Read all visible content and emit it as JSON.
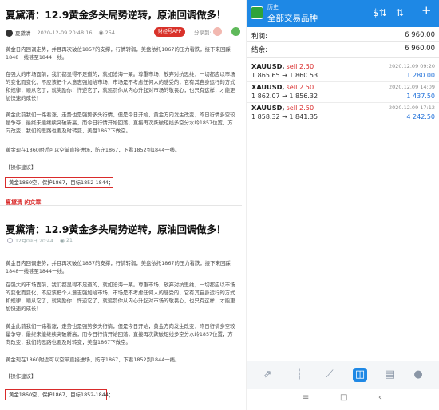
{
  "article": {
    "title": "夏黛清：12.9黄金多头局势逆转，原油回调做多！",
    "author": "夏黛清",
    "date": "2020-12-09 20:48:16",
    "views": "254",
    "app_button": "财经号APP",
    "share_label": "分享到:",
    "paragraphs": [
      "黄金日内回调走势，并且再次破位1857的支撑，行情转弱，美盘依托1867的压力看跌，接下来回踩1848一线甚至1844一线。",
      "在强大的市场面前，我们都显得不足道的，就如沧海一粟。尊重市场，放弃对抗思维，一切都应以市场的变化而变化，不应该把个人意志强加给市场，市场是不考虑任何人的感受的，它有其自身运行的方式和规律，顺从它了，就奖励你！忤逆它了，就惩罚你从内心升起对市场的敬畏心，也只有这样，才能更加快速的成长！",
      "黄金此前我们一路看涨，走势也是强势多头行情，但是今日开始，黄金方向发生改变，昨日行情多空较量争夺，最终未能继续突破新高，而今日行情开始回落，直接再次跌破短线多空分水岭1857位置，方向改变，我们的思路也要及时转变，美盘1867下做空。",
      "黄金现在1860附近可以空单直接进场，防守1867，下看1852到1844一线。"
    ],
    "advice_label": "【操作建议】",
    "advice": "黄金1860空，保护1867，目标1852-1844；",
    "source_tag": "夏黛清 的文章",
    "date2": "12月09日 20:44",
    "views2": "21"
  },
  "trading_app": {
    "history_label": "历史",
    "screen_title": "全部交易品种",
    "summary": [
      {
        "label": "利润:",
        "value": "6 960.00"
      },
      {
        "label": "结余:",
        "value": "6 960.00"
      }
    ],
    "trades": [
      {
        "symbol": "XAUUSD,",
        "side": "sell 2.50",
        "prices": "1 865.65 → 1 860.53",
        "time": "2020.12.09 09:20",
        "profit": "1 280.00"
      },
      {
        "symbol": "XAUUSD,",
        "side": "sell 2.50",
        "prices": "1 862.07 → 1 856.32",
        "time": "2020.12.09 14:09",
        "profit": "1 437.50"
      },
      {
        "symbol": "XAUUSD,",
        "side": "sell 2.50",
        "prices": "1 858.32 → 1 841.35",
        "time": "2020.12.09 17:12",
        "profit": "4 242.50"
      }
    ],
    "icons": {
      "toolbar": [
        "dollar-exchange-icon",
        "sort-icon",
        "plus-icon"
      ],
      "bottom_nav": [
        "quotes-icon",
        "chart-icon",
        "trade-icon",
        "history-icon",
        "news-icon",
        "chat-icon"
      ],
      "system_nav": [
        "menu-icon",
        "home-icon",
        "back-icon"
      ]
    },
    "colors": {
      "header": "#1e88e5",
      "sell": "#d92b2b",
      "profit": "#1e6fd9"
    }
  }
}
